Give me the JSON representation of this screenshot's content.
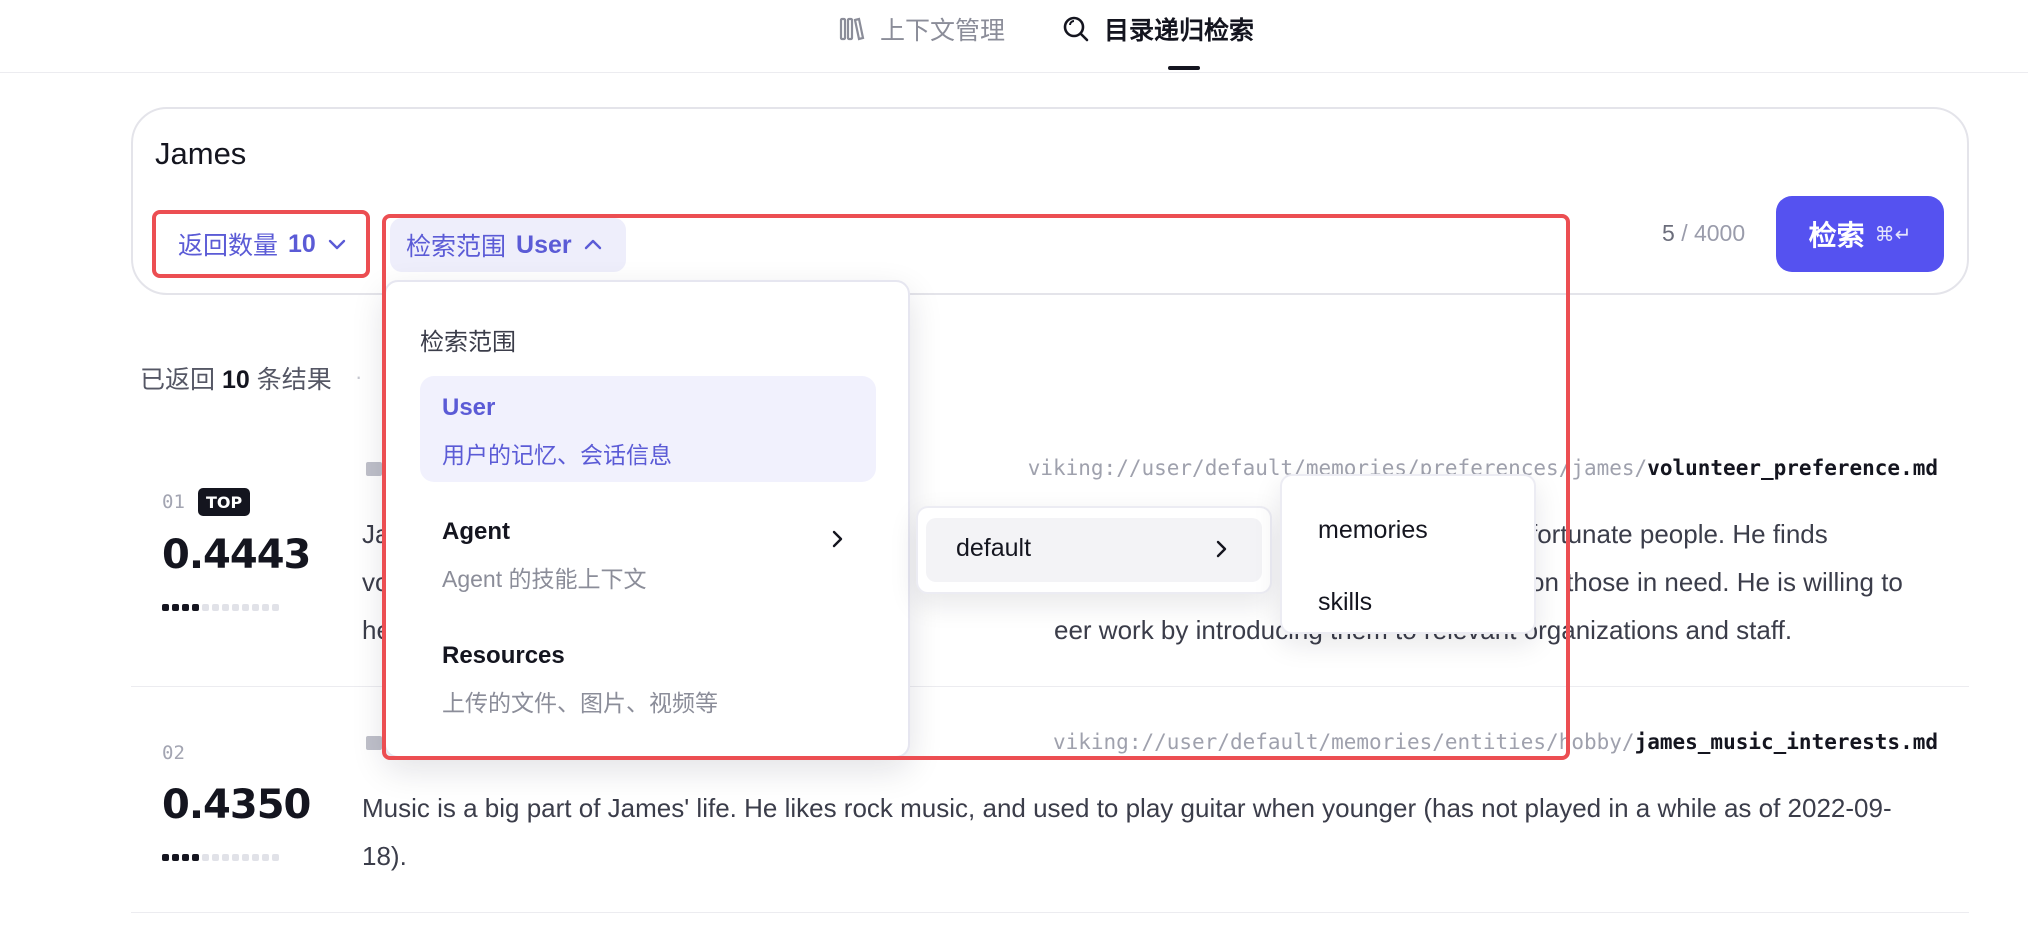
{
  "tabs": [
    {
      "label": "上下文管理",
      "icon": "library-icon",
      "active": false
    },
    {
      "label": "目录递归检索",
      "icon": "search-icon",
      "active": true
    }
  ],
  "search": {
    "query": "James",
    "count_label": "返回数量",
    "count_value": "10",
    "scope_label": "检索范围",
    "scope_value": "User",
    "char_used": "5",
    "char_max": "/ 4000",
    "button_label": "检索",
    "shortcut": "⌘↵"
  },
  "results_header": {
    "prefix": "已返回",
    "count": "10",
    "suffix": "条结果"
  },
  "results": [
    {
      "rank": "01",
      "badge": "TOP",
      "score": "0.4443",
      "score_fraction": 0.4443,
      "path_prefix": "viking://user/default/memories/preferences/james/",
      "path_file": "volunteer_preference.md",
      "lines": [
        {
          "a": "Ja",
          "b": "fortunate people. He finds"
        },
        {
          "a": "vo",
          "b": "on those in need. He is willing to"
        },
        {
          "a": "he",
          "b": "eer work by introducing them to relevant organizations and staff."
        }
      ]
    },
    {
      "rank": "02",
      "score": "0.4350",
      "score_fraction": 0.435,
      "path_prefix": "viking://user/default/memories/entities/hobby/",
      "path_file": "james_music_interests.md",
      "text": "Music is a big part of James' life. He likes rock music, and used to play guitar when younger (has not played in a while as of 2022-09-18)."
    }
  ],
  "scope_menu": {
    "title": "检索范围",
    "options": [
      {
        "label": "User",
        "desc": "用户的记忆、会话信息",
        "selected": true
      },
      {
        "label": "Agent",
        "desc": "Agent 的技能上下文",
        "has_submenu": true
      },
      {
        "label": "Resources",
        "desc": "上传的文件、图片、视频等"
      }
    ],
    "submenu": {
      "label": "default"
    },
    "submenu2": [
      "memories",
      "skills"
    ]
  },
  "colors": {
    "accent": "#5552f0",
    "highlight": "#ec4e52",
    "selected_bg": "#f1f1fd"
  }
}
